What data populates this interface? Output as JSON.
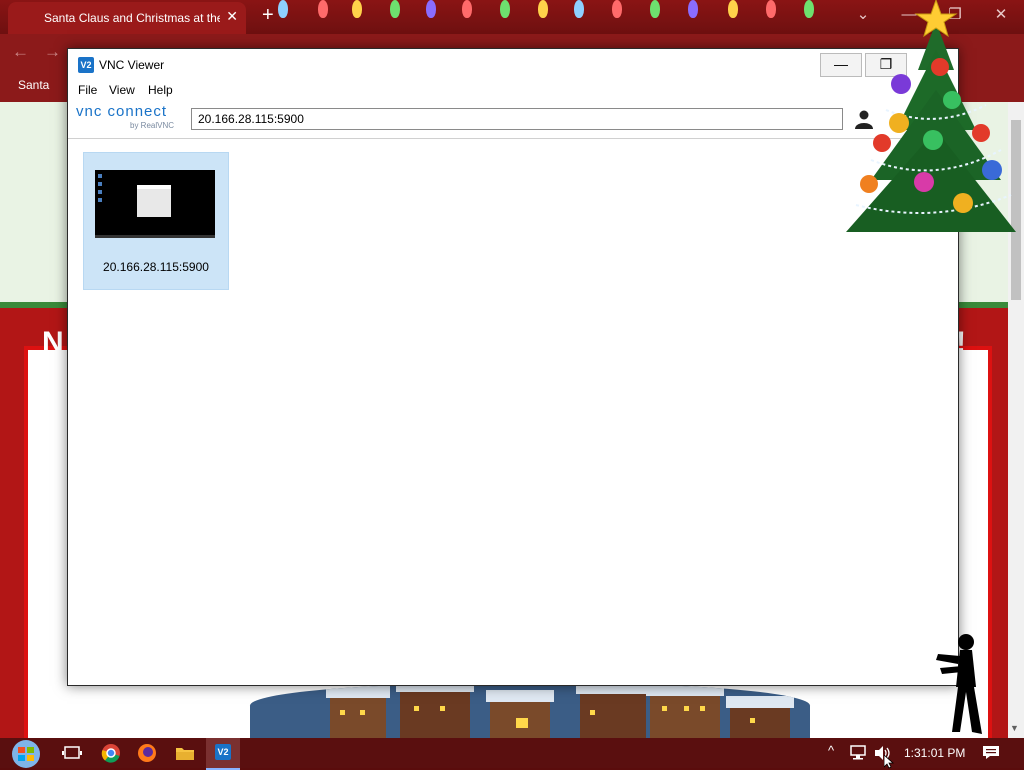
{
  "browser": {
    "tab_title": "Santa Claus and Christmas at the",
    "tab_close": "✕",
    "new_tab": "+",
    "bookmark_label": "Santa"
  },
  "page": {
    "heading_start": "N",
    "heading_end": "!"
  },
  "vnc": {
    "title": "VNC Viewer",
    "app_icon_text": "V2",
    "window_buttons": {
      "minimize": "—",
      "maximize": "❐"
    },
    "menu": [
      "File",
      "View",
      "Help"
    ],
    "logo_main": "vnc connect",
    "logo_sub": "by RealVNC",
    "address_value": "20.166.28.115:5900",
    "connections": [
      {
        "label": "20.166.28.115:5900"
      }
    ]
  },
  "taskbar": {
    "vnc_icon_text": "V2",
    "tray_chevron": "^",
    "clock": "1:31:01 PM"
  },
  "colors": {
    "vnc_accent": "#1a73c8",
    "tile_selected": "#cce4f7",
    "browser_red": "#8c1a1a",
    "page_red": "#b21616",
    "taskbar": "#5a0f0f"
  }
}
